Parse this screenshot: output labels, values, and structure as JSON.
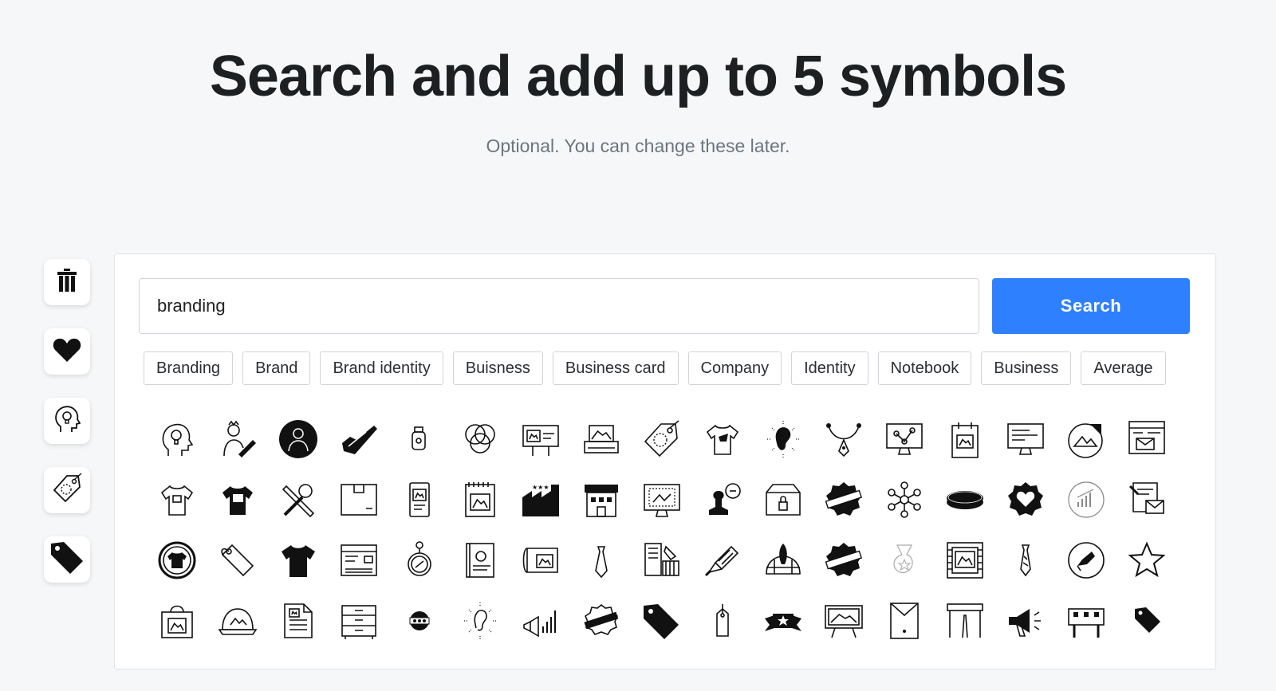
{
  "header": {
    "title": "Search and add up to 5 symbols",
    "subtitle": "Optional. You can change these later."
  },
  "sidebar": {
    "items": [
      {
        "icon": "trash-icon"
      },
      {
        "icon": "heart-icon"
      },
      {
        "icon": "head-lightbulb-icon"
      },
      {
        "icon": "price-tag-outline-icon"
      },
      {
        "icon": "price-tag-solid-icon"
      }
    ]
  },
  "search": {
    "value": "branding",
    "placeholder": "",
    "button_label": "Search"
  },
  "tags": [
    "Branding",
    "Brand",
    "Brand identity",
    "Buisness",
    "Business card",
    "Company",
    "Identity",
    "Notebook",
    "Business",
    "Average"
  ],
  "icons": [
    "head-lightbulb-icon",
    "designer-pencil-icon",
    "avatar-circle-icon",
    "sneaker-icon",
    "bottle-icon",
    "venn-circles-icon",
    "billboard-icon",
    "image-printer-icon",
    "tag-dotted-icon",
    "tshirt-icon",
    "ear-sound-icon",
    "pen-tool-vector-icon",
    "monitor-network-icon",
    "clipboard-image-icon",
    "monitor-text-icon",
    "sticker-mountain-icon",
    "envelope-layout-icon",
    "tshirt-outline-icon",
    "tshirt-print-icon",
    "wrench-pencil-icon",
    "box-icon",
    "phone-image-icon",
    "notepad-image-icon",
    "factory-stars-icon",
    "storefront-icon",
    "monitor-design-icon",
    "stamp-icon",
    "package-lock-icon",
    "badge-banner-icon",
    "network-nodes-icon",
    "disc-icon",
    "heart-badge-icon",
    "chart-circle-icon",
    "document-mail-icon",
    "tshirt-badge-icon",
    "tag-outline-icon",
    "tshirt-solid-icon",
    "business-card-icon",
    "keychain-icon",
    "book-cover-icon",
    "map-scroll-icon",
    "necktie-icon",
    "brand-guide-icon",
    "megaphone-hand-icon",
    "rocket-globe-icon",
    "badge-ribbon-icon",
    "star-badge-light-icon",
    "picture-frame-icon",
    "necktie-outline-icon",
    "megaphone-circle-icon",
    "star-icon",
    "shopping-bag-icon",
    "cap-icon",
    "document-icon",
    "filing-cabinet-icon",
    "pill-badge-icon",
    "ear-rays-icon",
    "megaphone-chart-icon",
    "seal-banner-icon",
    "tag-solid-icon",
    "hang-tag-icon",
    "ribbon-star-icon",
    "billboard-sign-icon",
    "envelope-doc-icon",
    "road-sign-icon",
    "megaphone-sound-icon",
    "signboard-icon",
    "tag-small-icon"
  ]
}
